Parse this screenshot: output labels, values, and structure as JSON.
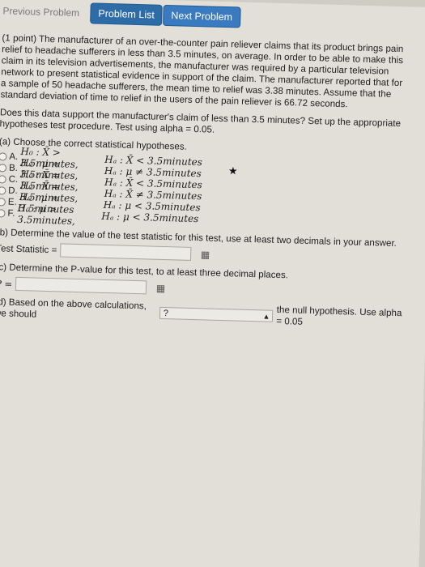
{
  "nav": {
    "previous": "Previous Problem",
    "problem_list": "Problem List",
    "next": "Next Problem"
  },
  "problem": {
    "intro": "(1 point) The manufacturer of an over-the-counter pain reliever claims that its product brings pain relief to headache sufferers in less than 3.5 minutes, on average. In order to be able to make this claim in its television advertisements, the manufacturer was required by a particular television network to present statistical evidence in support of the claim. The manufacturer reported that for a sample of 50 headache sufferers, the mean time to relief was 3.38 minutes. Assume that the standard deviation of time to relief in the users of the pain reliever is 66.72 seconds.",
    "question": "Does this data support the manufacturer's claim of less than 3.5 minutes? Set up the appropriate hypotheses test procedure. Test using alpha = 0.05.",
    "part_a": {
      "label": "(a) Choose the correct statistical hypotheses.",
      "options": [
        {
          "letter": "A.",
          "h0": "H₀ : X̄ > 3.5minutes,",
          "ha": "Hₐ : X̄ < 3.5minutes"
        },
        {
          "letter": "B.",
          "h0": "H₀ : μ = 3.5minutes,",
          "ha": "Hₐ : μ ≠ 3.5minutes"
        },
        {
          "letter": "C.",
          "h0": "H₀ : X̄ = 3.5minutes,",
          "ha": "Hₐ : X̄ < 3.5minutes"
        },
        {
          "letter": "D.",
          "h0": "H₀ : X̄ = 3.5minutes,",
          "ha": "Hₐ : X̄ ≠ 3.5minutes"
        },
        {
          "letter": "E.",
          "h0": "H₀ : μ = 3.5minutes",
          "ha": "Hₐ : μ < 3.5minutes"
        },
        {
          "letter": "F.",
          "h0": "H₀ : μ > 3.5minutes,",
          "ha": "Hₐ : μ < 3.5minutes"
        }
      ],
      "mark": "★"
    },
    "part_b": {
      "label": "(b) Determine the value of the test statistic for this test, use at least two decimals in your answer.",
      "field_label": "Test Statistic =",
      "value": ""
    },
    "part_c": {
      "label": "(c) Determine the P-value for this test, to at least three decimal places.",
      "field_label": "P =",
      "value": ""
    },
    "part_d": {
      "prefix": "(d) Based on the above calculations, we should",
      "select_value": "?",
      "suffix": "the null hypothesis. Use alpha = 0.05"
    }
  }
}
